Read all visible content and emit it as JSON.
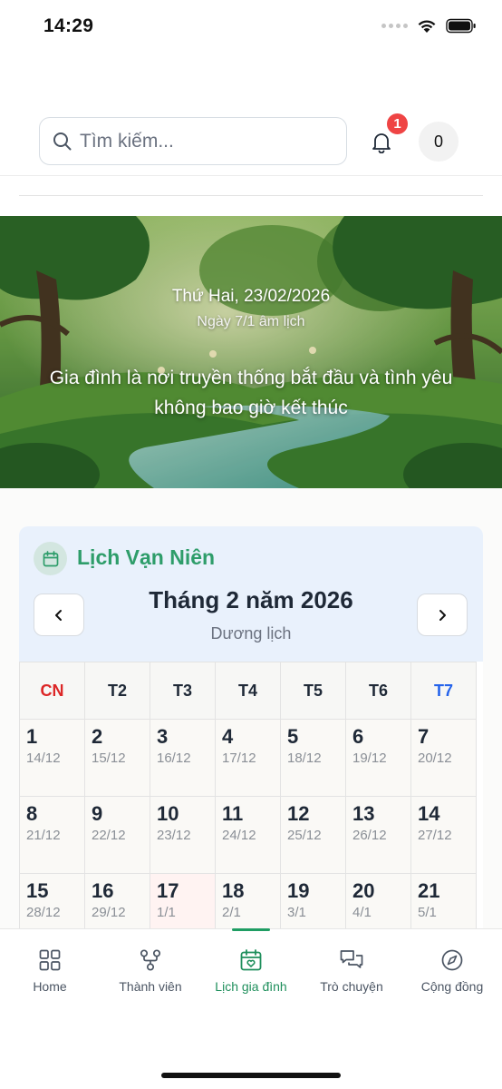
{
  "status_bar": {
    "time": "14:29"
  },
  "header": {
    "search_placeholder": "Tìm kiếm...",
    "notification_count": "1",
    "points": "0"
  },
  "banner": {
    "date": "Thứ Hai, 23/02/2026",
    "lunar_date": "Ngày 7/1 âm lịch",
    "quote": "Gia đình là nơi truyền thống bắt đầu và tình yêu không bao giờ kết thúc"
  },
  "calendar": {
    "title": "Lịch Vạn Niên",
    "month_title": "Tháng 2 năm 2026",
    "calendar_type": "Dương lịch",
    "weekdays": [
      "CN",
      "T2",
      "T3",
      "T4",
      "T5",
      "T6",
      "T7"
    ],
    "weeks": [
      [
        {
          "day": "1",
          "lunar": "14/12"
        },
        {
          "day": "2",
          "lunar": "15/12"
        },
        {
          "day": "3",
          "lunar": "16/12"
        },
        {
          "day": "4",
          "lunar": "17/12"
        },
        {
          "day": "5",
          "lunar": "18/12"
        },
        {
          "day": "6",
          "lunar": "19/12"
        },
        {
          "day": "7",
          "lunar": "20/12"
        }
      ],
      [
        {
          "day": "8",
          "lunar": "21/12"
        },
        {
          "day": "9",
          "lunar": "22/12"
        },
        {
          "day": "10",
          "lunar": "23/12"
        },
        {
          "day": "11",
          "lunar": "24/12"
        },
        {
          "day": "12",
          "lunar": "25/12"
        },
        {
          "day": "13",
          "lunar": "26/12"
        },
        {
          "day": "14",
          "lunar": "27/12"
        }
      ],
      [
        {
          "day": "15",
          "lunar": "28/12"
        },
        {
          "day": "16",
          "lunar": "29/12"
        },
        {
          "day": "17",
          "lunar": "1/1"
        },
        {
          "day": "18",
          "lunar": "2/1"
        },
        {
          "day": "19",
          "lunar": "3/1"
        },
        {
          "day": "20",
          "lunar": "4/1"
        },
        {
          "day": "21",
          "lunar": "5/1"
        }
      ]
    ]
  },
  "bottom_nav": {
    "items": [
      {
        "label": "Home",
        "icon": "grid-icon"
      },
      {
        "label": "Thành viên",
        "icon": "members-icon"
      },
      {
        "label": "Lịch gia đình",
        "icon": "calendar-heart-icon"
      },
      {
        "label": "Trò chuyện",
        "icon": "chat-icon"
      },
      {
        "label": "Cộng đồng",
        "icon": "compass-icon"
      }
    ],
    "active_index": 2
  },
  "colors": {
    "accent": "#2e9d6a",
    "badge": "#ef4444",
    "sunday": "#dc2626",
    "saturday": "#2563eb",
    "calendar_header_bg": "#e9f1fc"
  }
}
